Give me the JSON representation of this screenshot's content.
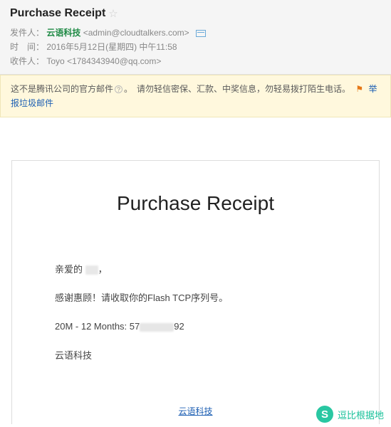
{
  "header": {
    "subject": "Purchase Receipt",
    "from_label": "发件人：",
    "from_name": "云语科技",
    "from_addr": "<admin@cloudtalkers.com>",
    "date_label": "时　间：",
    "date_value": "2016年5月12日(星期四) 中午11:58",
    "to_label": "收件人：",
    "to_name": "Toyo",
    "to_addr": "<1784343940@qq.com>"
  },
  "warning": {
    "text_a": "这不是腾讯公司的官方邮件",
    "text_b": "。　请勿轻信密保、汇款、中奖信息，勿轻易拨打陌生电话。",
    "report": "举报垃圾邮件"
  },
  "body": {
    "title": "Purchase Receipt",
    "greeting_prefix": "亲爱的 ",
    "greeting_suffix": "，",
    "line_thanks": "感谢惠顾！请收取你的Flash TCP序列号。",
    "serial_prefix": "20M - 12 Months: 57",
    "serial_suffix": "92",
    "sign": "云语科技",
    "footer_link": "云语科技"
  },
  "watermark": {
    "glyph": "S",
    "text": "逗比根据地"
  }
}
